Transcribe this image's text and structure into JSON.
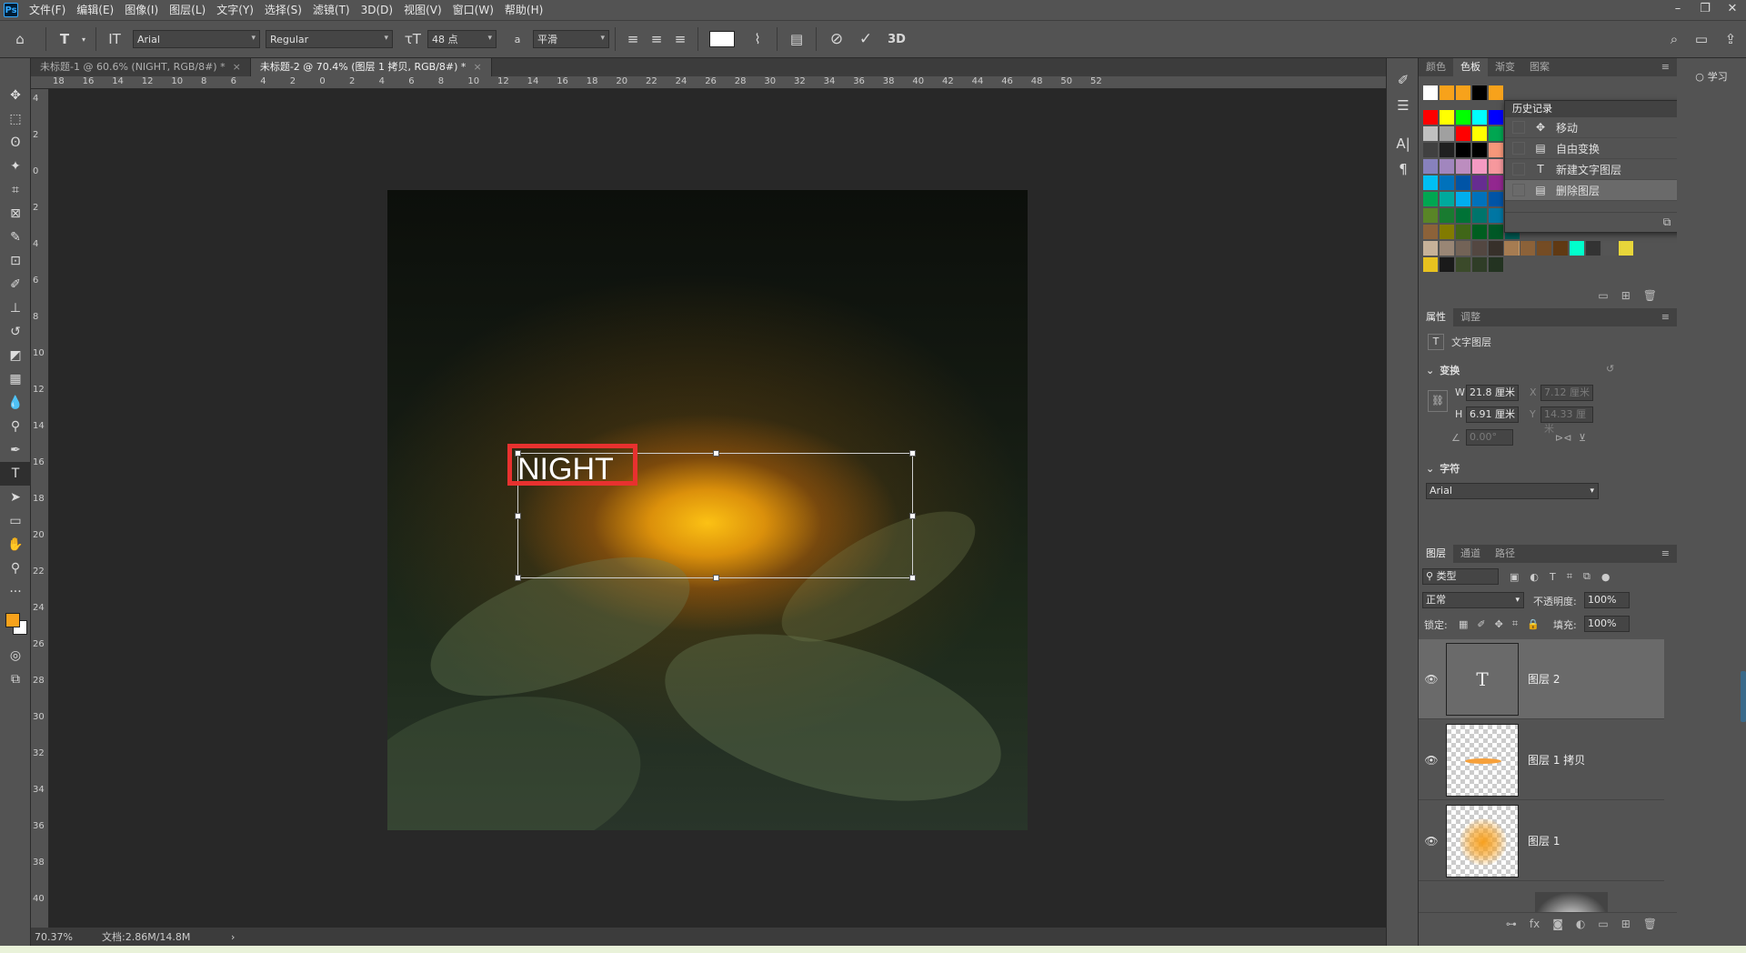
{
  "app": {
    "logo": "Ps",
    "menus": [
      "文件(F)",
      "编辑(E)",
      "图像(I)",
      "图层(L)",
      "文字(Y)",
      "选择(S)",
      "滤镜(T)",
      "3D(D)",
      "视图(V)",
      "窗口(W)",
      "帮助(H)"
    ],
    "window_controls": [
      "–",
      "❐",
      "✕"
    ]
  },
  "options_bar": {
    "font_family": "Arial",
    "font_style": "Regular",
    "font_size": "48 点",
    "aa_label": "a",
    "antialias": "平滑",
    "threeD": "3D",
    "text_color": "#ffffff"
  },
  "doc_tabs": [
    {
      "label": "未标题-1 @ 60.6% (NIGHT, RGB/8#) *",
      "active": false
    },
    {
      "label": "未标题-2 @ 70.4% (图层 1 拷贝, RGB/8#) *",
      "active": true
    }
  ],
  "ruler_top": [
    "18",
    "16",
    "14",
    "12",
    "10",
    "8",
    "6",
    "4",
    "2",
    "0",
    "2",
    "4",
    "6",
    "8",
    "10",
    "12",
    "14",
    "16",
    "18",
    "20",
    "22",
    "24",
    "26",
    "28",
    "30",
    "32",
    "34",
    "36",
    "38",
    "40",
    "42",
    "44",
    "46",
    "48",
    "50",
    "52"
  ],
  "ruler_left": [
    "4",
    "2",
    "0",
    "2",
    "4",
    "6",
    "8",
    "10",
    "12",
    "14",
    "16",
    "18",
    "20",
    "22",
    "24",
    "26",
    "28",
    "30",
    "32",
    "34",
    "36",
    "38",
    "40"
  ],
  "canvas": {
    "text": "NIGHT"
  },
  "status": {
    "zoom": "70.37%",
    "doc": "文档:2.86M/14.8M",
    "arrow": "›"
  },
  "swatch_panel": {
    "tabs": [
      "颜色",
      "色板",
      "渐变",
      "图案"
    ],
    "active_tab": "色板",
    "recent": [
      "#ffffff",
      "#f7a21b",
      "#f7a21b",
      "#000000",
      "#f7a21b"
    ],
    "grid": [
      [
        "#ff0000",
        "#ffff00",
        "#00ff00",
        "#00ffff",
        "#0000ff",
        "#ff00ff"
      ],
      [
        "#c0c0c0",
        "#a0a0a0",
        "#ff0000",
        "#ffff00",
        "#00a651",
        "#00aeef"
      ],
      [
        "#404040",
        "#202020",
        "#000000",
        "#000000",
        "#f7977a",
        "#fdc689"
      ],
      [
        "#8781bd",
        "#a186be",
        "#bc8dbf",
        "#f49ac2",
        "#f6989d",
        "#f9ad81"
      ],
      [
        "#00bff3",
        "#0072bc",
        "#0054a6",
        "#662d91",
        "#92278f",
        "#ec008c"
      ],
      [
        "#00a651",
        "#00a99d",
        "#00aeef",
        "#0072bc",
        "#0054a6",
        "#2e3192"
      ],
      [
        "#598527",
        "#197b30",
        "#007236",
        "#00746b",
        "#0076a3",
        "#004b80"
      ],
      [
        "#8c6239",
        "#827b00",
        "#406618",
        "#005e20",
        "#005826",
        "#005952"
      ],
      [
        "#c7b299",
        "#998675",
        "#736357",
        "#534741",
        "#37302a",
        "#c69c6d"
      ],
      [
        "#e8c21f",
        "#1a1a1a",
        "#3b4a2a",
        "#2f3d27",
        "#233321"
      ]
    ],
    "grid_right": [
      "#a67c52",
      "#8c6239",
      "#754c24",
      "#603913",
      "#00ffcc",
      "#333333",
      "#555555",
      "#e8d63a"
    ]
  },
  "history": {
    "title": "历史记录",
    "items": [
      {
        "icon": "✥",
        "label": "移动",
        "selected": false
      },
      {
        "icon": "▤",
        "label": "自由变换",
        "selected": false
      },
      {
        "icon": "T",
        "label": "新建文字图层",
        "selected": false
      },
      {
        "icon": "▤",
        "label": "删除图层",
        "selected": true
      }
    ]
  },
  "learn": {
    "label": "学习"
  },
  "properties": {
    "tabs": [
      "属性",
      "调整"
    ],
    "layer_type": "文字图层",
    "transform_title": "变换",
    "w_label": "W",
    "w_value": "21.8 厘米",
    "h_label": "H",
    "h_value": "6.91 厘米",
    "x_label": "X",
    "x_value": "7.12 厘米",
    "y_label": "Y",
    "y_value": "14.33 厘米",
    "angle": "0.00°",
    "char_title": "字符",
    "char_font": "Arial"
  },
  "layers_panel": {
    "tabs": [
      "图层",
      "通道",
      "路径"
    ],
    "filter": "类型",
    "blend": "正常",
    "opacity_label": "不透明度:",
    "opacity": "100%",
    "lock_label": "锁定:",
    "fill_label": "填充:",
    "fill": "100%",
    "layers": [
      {
        "name": "图层 2",
        "type": "text",
        "selected": true
      },
      {
        "name": "图层 1 拷贝",
        "type": "streak",
        "selected": false
      },
      {
        "name": "图层 1",
        "type": "glow",
        "selected": false
      }
    ],
    "footer_icons": [
      "⊶",
      "fx",
      "◙",
      "◐",
      "▭",
      "⊞",
      "🗑"
    ]
  }
}
